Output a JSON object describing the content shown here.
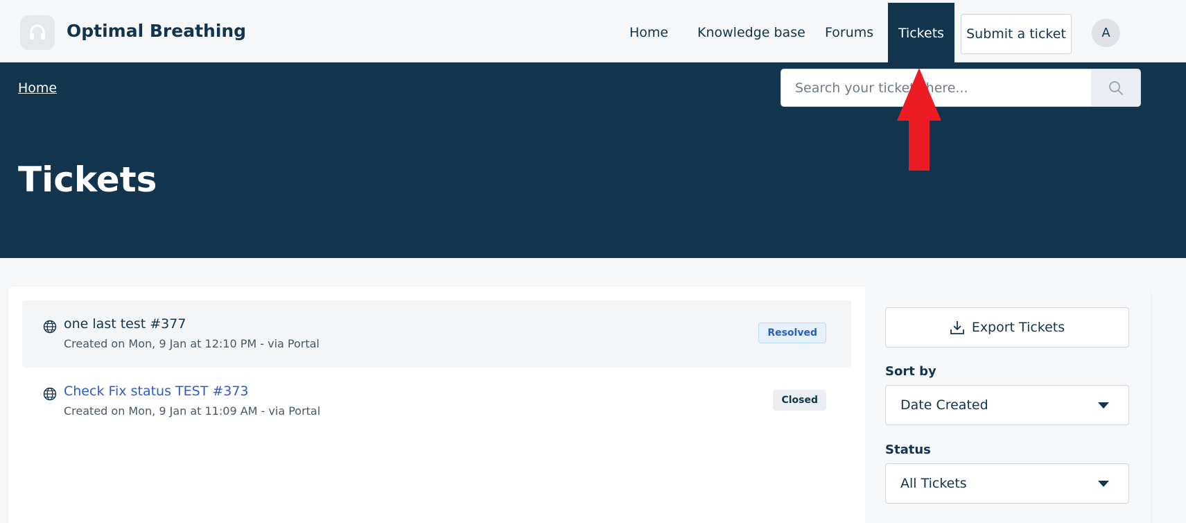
{
  "header": {
    "brand": "Optimal Breathing",
    "nav": {
      "home": "Home",
      "knowledge_base": "Knowledge base",
      "forums": "Forums",
      "tickets": "Tickets"
    },
    "submit_ticket": "Submit a ticket",
    "avatar_initial": "A"
  },
  "hero": {
    "breadcrumb": "Home",
    "search_placeholder": "Search your tickets here...",
    "title": "Tickets"
  },
  "tickets": [
    {
      "title": "one last test #377",
      "meta": "Created on Mon, 9 Jan at 12:10 PM - via Portal",
      "status": "Resolved",
      "icon": "globe-icon"
    },
    {
      "title": "Check Fix status TEST #373",
      "meta": "Created on Mon, 9 Jan at 11:09 AM - via Portal",
      "status": "Closed",
      "icon": "globe-icon"
    }
  ],
  "sidebar": {
    "export_label": "Export Tickets",
    "sort_label": "Sort by",
    "sort_value": "Date Created",
    "status_label": "Status",
    "status_value": "All Tickets"
  },
  "colors": {
    "primary": "#12344d",
    "annotation_arrow": "#ed1c24",
    "link": "#2c5cc5"
  }
}
